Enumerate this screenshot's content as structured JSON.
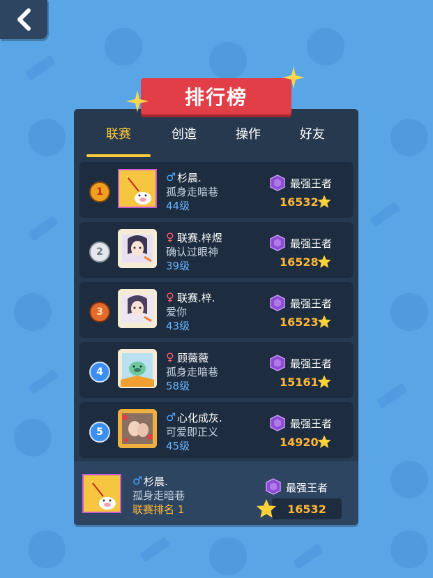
{
  "title": "排行榜",
  "tabs": [
    {
      "label": "联赛",
      "active": true
    },
    {
      "label": "创造",
      "active": false
    },
    {
      "label": "操作",
      "active": false
    },
    {
      "label": "好友",
      "active": false
    }
  ],
  "rows": [
    {
      "rank": "1",
      "gender": "♂",
      "name": "杉晨.",
      "motto": "孤身走暗巷",
      "level": "44级",
      "tier": "最强王者",
      "score": "16532"
    },
    {
      "rank": "2",
      "gender": "♀",
      "name": "联赛.梓煜",
      "motto": "确认过眼神",
      "level": "39级",
      "tier": "最强王者",
      "score": "16528"
    },
    {
      "rank": "3",
      "gender": "♀",
      "name": "联赛.梓.",
      "motto": "爱你",
      "level": "43级",
      "tier": "最强王者",
      "score": "16523"
    },
    {
      "rank": "4",
      "gender": "♀",
      "name": "顾薇薇",
      "motto": "孤身走暗巷",
      "level": "58级",
      "tier": "最强王者",
      "score": "15161"
    },
    {
      "rank": "5",
      "gender": "♂",
      "name": "心化成灰.",
      "motto": "可爱即正义",
      "level": "45级",
      "tier": "最强王者",
      "score": "14920"
    }
  ],
  "me": {
    "gender": "♂",
    "name": "杉晨.",
    "motto": "孤身走暗巷",
    "rank_text": "联赛排名 1",
    "tier": "最强王者",
    "score": "16532"
  },
  "colors": {
    "background": "#5aa5e6",
    "panel": "#26394f",
    "accent": "#ffcb3a",
    "banner": "#e23e47",
    "score": "#ffb73a"
  },
  "icons": {
    "back": "chevron-left-icon",
    "tier": "purple-gem-icon",
    "score": "star-icon"
  }
}
